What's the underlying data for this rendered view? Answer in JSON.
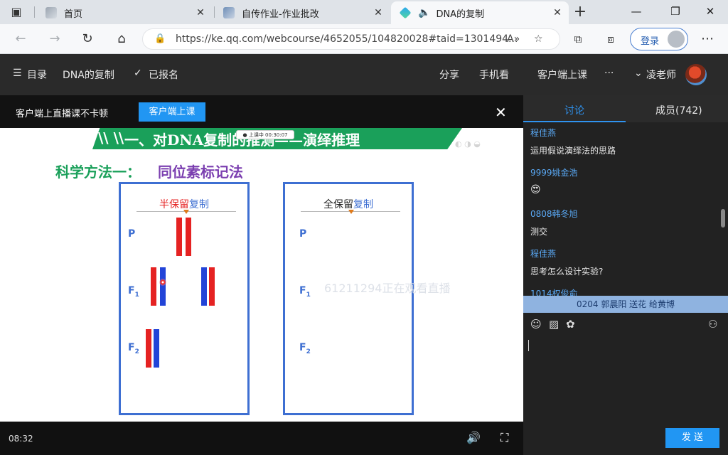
{
  "browser": {
    "tabs": [
      {
        "label": "首页"
      },
      {
        "label": "自传作业-作业批改"
      },
      {
        "label": "DNA的复制"
      }
    ],
    "new_tab": "+",
    "url": "https://ke.qq.com/webcourse/4652055/104820028#taid=1301494...",
    "login_label": "登录"
  },
  "site_header": {
    "menu_label": "目录",
    "course_title": "DNA的复制",
    "enrolled_label": "已报名",
    "share_label": "分享",
    "mobile_label": "手机看",
    "client_label": "客户端上课",
    "more_label": "···",
    "teacher_label": "凌老师"
  },
  "notice": {
    "text": "客户端上直播课不卡顿",
    "button_label": "客户端上课",
    "close": "✕"
  },
  "slide": {
    "banner_title": "一、对DNA复制的推测——演绎推理",
    "clock_pill": "● 上课中 00:30:07",
    "method_prefix": "科学方法一：",
    "method_name": "同位素标记法",
    "left_panel": {
      "title_red": "半保留",
      "title_blue": "复制"
    },
    "right_panel": {
      "title_black": "全保留",
      "title_blue": "复制"
    },
    "gen_p": "P",
    "gen_f1": "F",
    "gen_f1_sub": "1",
    "gen_f2": "F",
    "gen_f2_sub": "2",
    "watermark": "61211294正在观看直播"
  },
  "video": {
    "time": "08:32"
  },
  "chat": {
    "tab_discuss": "讨论",
    "tab_members": "成员(742)",
    "messages": [
      {
        "user": "程佳燕",
        "text": "运用假说演绎法的思路"
      },
      {
        "user": "9999姚金浩",
        "text": "😍"
      },
      {
        "user": "0808韩冬旭",
        "text": "测交"
      },
      {
        "user": "程佳燕",
        "text": "思考怎么设计实验?"
      },
      {
        "user": "1014权俊俞",
        "text": ""
      }
    ],
    "gift_notice": "0204 郭晨阳 送花 给黄博",
    "send_label": "发 送"
  },
  "colors": {
    "accent_blue": "#2196f3",
    "slide_green": "#1aa05a",
    "strand_red": "#e52222",
    "strand_blue": "#2244d8",
    "panel_border": "#3e6fd2"
  }
}
